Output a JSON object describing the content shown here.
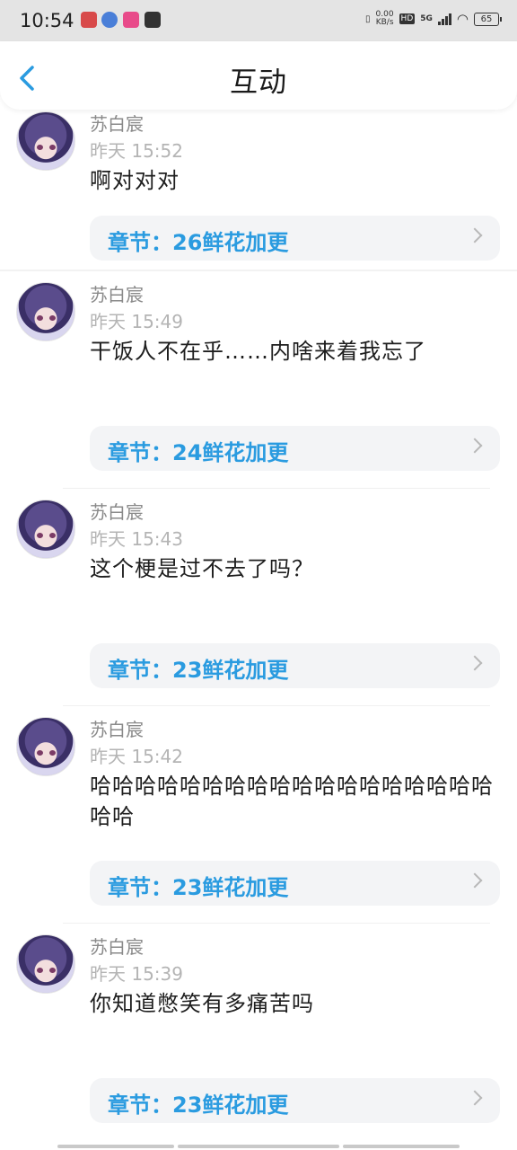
{
  "status_bar": {
    "time": "10:54",
    "net_speed_value": "0.00",
    "net_speed_unit": "KB/s",
    "hd": "HD",
    "network": "5G",
    "battery": "65"
  },
  "header": {
    "title": "互动"
  },
  "comments": [
    {
      "name": "苏白宸",
      "time": "昨天 15:52",
      "text": "啊对对对",
      "chapter": "章节：26鲜花加更"
    },
    {
      "name": "苏白宸",
      "time": "昨天 15:49",
      "text": "干饭人不在乎……内啥来着我忘了",
      "chapter": "章节：24鲜花加更"
    },
    {
      "name": "苏白宸",
      "time": "昨天 15:43",
      "text": "这个梗是过不去了吗？",
      "chapter": "章节：23鲜花加更"
    },
    {
      "name": "苏白宸",
      "time": "昨天 15:42",
      "text": "哈哈哈哈哈哈哈哈哈哈哈哈哈哈哈哈哈哈哈哈",
      "chapter": "章节：23鲜花加更"
    },
    {
      "name": "苏白宸",
      "time": "昨天 15:39",
      "text": "你知道憋笑有多痛苦吗",
      "chapter": "章节：23鲜花加更"
    }
  ]
}
